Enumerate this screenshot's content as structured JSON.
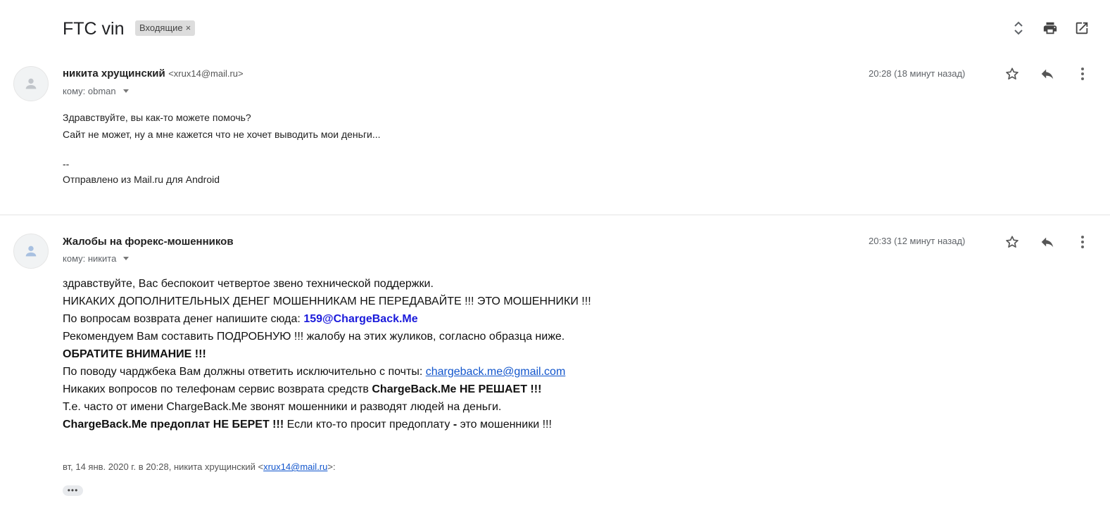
{
  "header": {
    "subject": "FTC vin",
    "label": "Входящие",
    "label_remove": "×",
    "icons": [
      "expand-collapse-icon",
      "print-icon",
      "open-new-window-icon"
    ]
  },
  "messages": [
    {
      "sender_name": "никита хрущинский",
      "sender_email": "<xrux14@mail.ru>",
      "to": "кому: obman",
      "time": "20:28 (18 минут назад)",
      "body": [
        "Здравствуйте, вы как-то можете помочь?",
        "Сайт не может, ну а мне кажется что не хочет выводить мои деньги...",
        "--",
        "Отправлено из Mail.ru для Android"
      ]
    },
    {
      "sender_name": "Жалобы на форекс-мошенников",
      "to": "кому: никита",
      "time": "20:33 (12 минут назад)",
      "body": {
        "l1": "здравствуйте, Вас беспокоит четвертое звено технической поддержки.",
        "l2": "НИКАКИХ ДОПОЛНИТЕЛЬНЫХ ДЕНЕГ МОШЕННИКАМ НЕ ПЕРЕДАВАЙТЕ !!! ЭТО МОШЕННИКИ !!!",
        "l3_text": "По вопросам возврата денег напишите сюда: ",
        "l3_link": "159@ChargeBack.Me",
        "l4": "Рекомендуем Вам составить ПОДРОБНУЮ !!! жалобу на этих жуликов, согласно образца ниже.",
        "l5": "ОБРАТИТЕ ВНИМАНИЕ !!!",
        "l6_text": "По поводу чарджбека Вам должны ответить исключительно с почты: ",
        "l6_link": "chargeback.me@gmail.com",
        "l7_text": "Никаких вопросов по телефонам сервис возврата средств ",
        "l7_bold": "ChargeBack.Me НЕ РЕШАЕТ !!!",
        "l8": "Т.е. часто от имени ChargeBack.Me звонят мошенники и разводят людей на деньги.",
        "l9_bold": "ChargeBack.Me предоплат НЕ БЕРЕТ !!!",
        "l9_text": " Если кто-то просит предоплату ",
        "l9_dash": "-",
        "l9_end": " это мошенники !!!"
      },
      "quote": {
        "prefix": "вт, 14 янв. 2020 г. в 20:28, никита хрущинский <",
        "email": "xrux14@mail.ru",
        "suffix": ">:",
        "show_trimmed": "•••"
      }
    }
  ]
}
